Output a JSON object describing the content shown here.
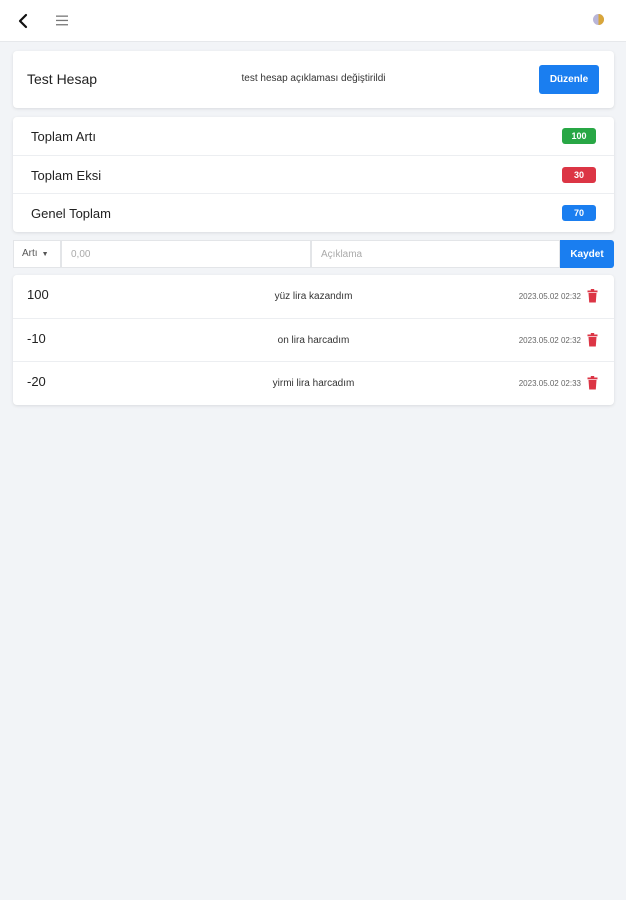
{
  "header": {
    "back_icon": "chevron-left-icon",
    "menu_icon": "hamburger-menu-icon",
    "avatar_icon": "avatar-icon"
  },
  "account": {
    "name": "Test Hesap",
    "description": "test hesap açıklaması değiştirildi",
    "edit_label": "Düzenle"
  },
  "totals": {
    "rows": [
      {
        "label": "Toplam Artı",
        "value": "100",
        "color": "#28a745"
      },
      {
        "label": "Toplam Eksi",
        "value": "30",
        "color": "#dc3545"
      },
      {
        "label": "Genel Toplam",
        "value": "70",
        "color": "#1a7ef0"
      }
    ]
  },
  "form": {
    "type_selected": "Artı",
    "amount_placeholder": "0,00",
    "description_placeholder": "Açıklama",
    "save_label": "Kaydet"
  },
  "entries": [
    {
      "amount": "100",
      "description": "yüz lira kazandım",
      "timestamp": "2023.05.02 02:32"
    },
    {
      "amount": "-10",
      "description": "on lira harcadım",
      "timestamp": "2023.05.02 02:32"
    },
    {
      "amount": "-20",
      "description": "yirmi lira harcadım",
      "timestamp": "2023.05.02 02:33"
    }
  ],
  "colors": {
    "primary": "#1a7ef0",
    "success": "#28a745",
    "danger": "#dc3545",
    "background": "#f2f4f7"
  }
}
